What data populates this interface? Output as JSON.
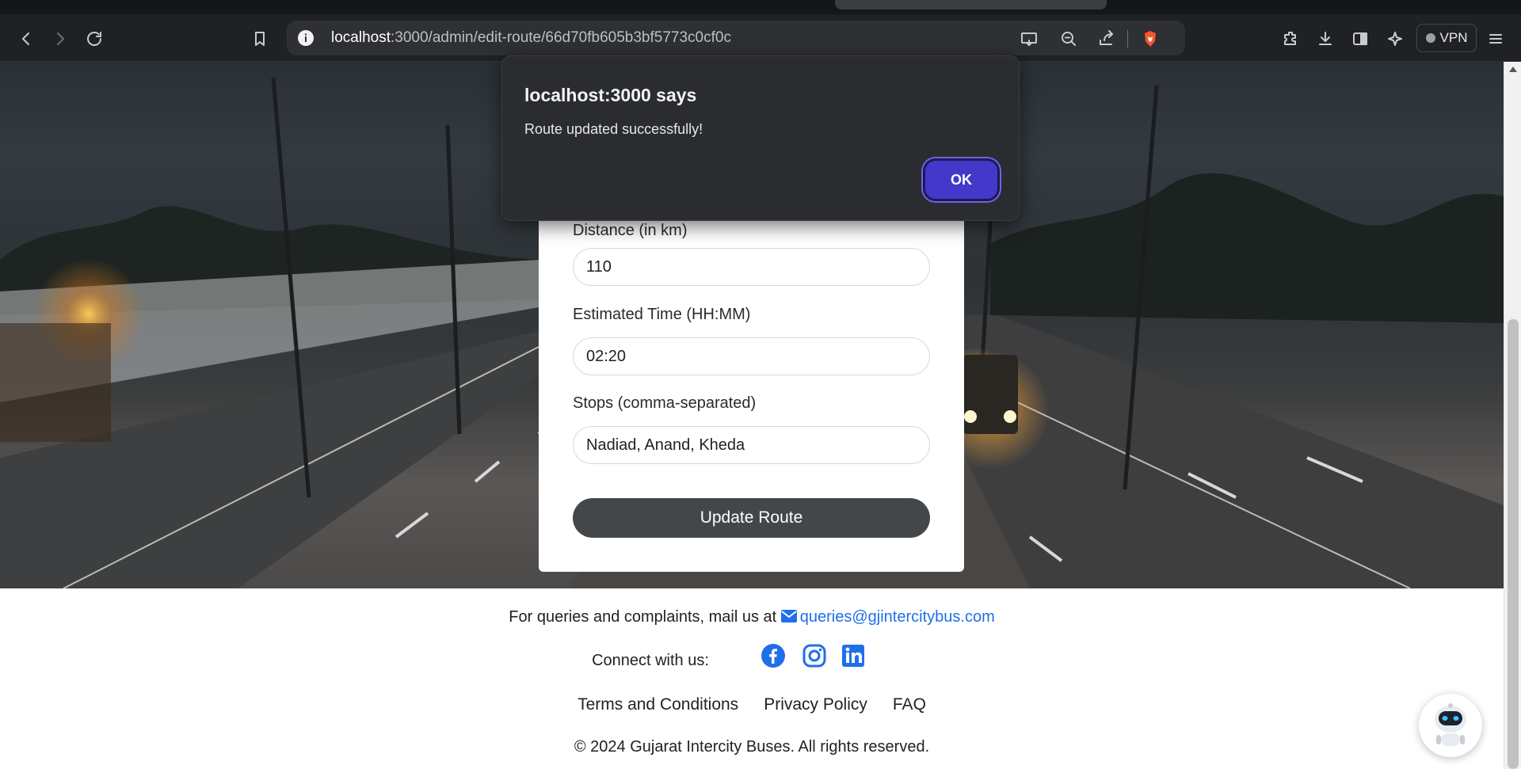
{
  "browser": {
    "url_host": "localhost",
    "url_rest": ":3000/admin/edit-route/66d70fb605b3bf5773c0cf0c",
    "vpn_label": "VPN"
  },
  "dialog": {
    "title": "localhost:3000 says",
    "message": "Route updated successfully!",
    "ok_label": "OK"
  },
  "form": {
    "distance_label": "Distance (in km)",
    "distance_value": "110",
    "time_label": "Estimated Time (HH:MM)",
    "time_value": "02:20",
    "stops_label": "Stops (comma-separated)",
    "stops_value": "Nadiad, Anand, Kheda",
    "submit_label": "Update Route"
  },
  "footer": {
    "mail_text": "For queries and complaints, mail us at",
    "mail_link": "queries@gjintercitybus.com",
    "connect_text": "Connect with us:",
    "links": [
      "Terms and Conditions",
      "Privacy Policy",
      "FAQ"
    ],
    "copyright": "© 2024 Gujarat Intercity Buses. All rights reserved."
  },
  "colors": {
    "accent_blue": "#1f6feb",
    "dialog_ok": "#4338ca",
    "button_dark": "#44474a"
  },
  "icons": {
    "social": [
      "facebook-icon",
      "instagram-icon",
      "linkedin-icon"
    ],
    "chatbot": "robot-icon"
  }
}
